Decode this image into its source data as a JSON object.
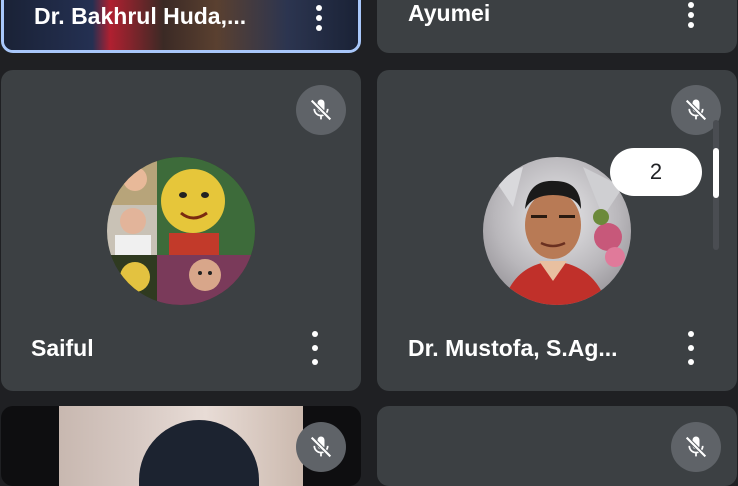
{
  "participants": [
    {
      "name": "Dr. Bakhrul Huda,..."
    },
    {
      "name": "Ayumei"
    },
    {
      "name": "Saiful"
    },
    {
      "name": "Dr. Mustofa, S.Ag..."
    }
  ],
  "page_indicator": {
    "label": "2"
  },
  "colors": {
    "background": "#1f2023",
    "tile": "#3c4043",
    "mute_button": "#5f6368",
    "active_border": "#a8c7fa"
  },
  "icons": [
    "mic-off-icon",
    "more-vert-icon"
  ]
}
